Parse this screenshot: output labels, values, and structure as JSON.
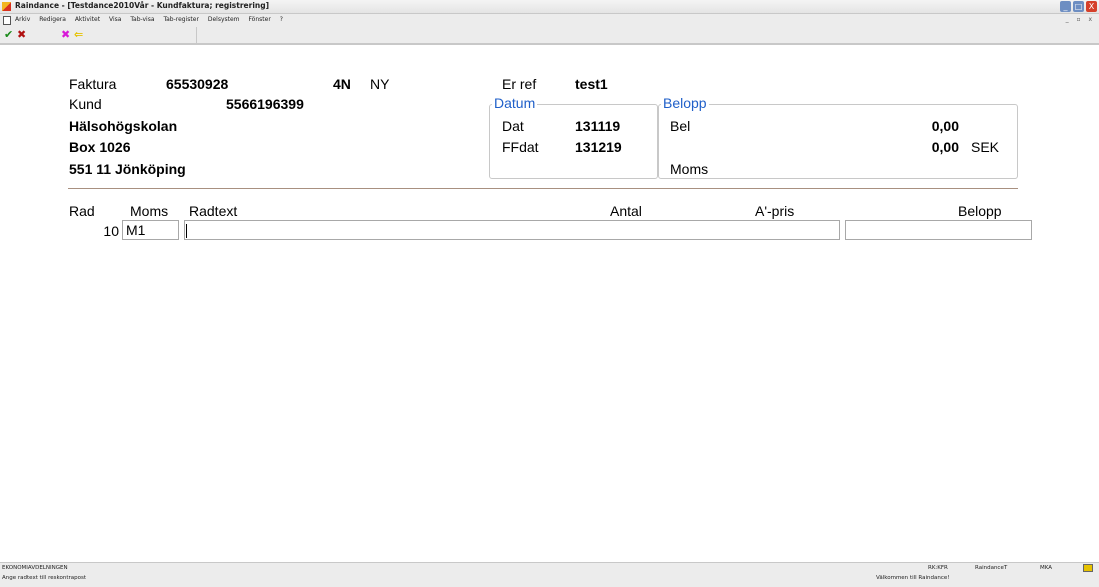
{
  "window": {
    "title": "Raindance - [Testdance2010Vår - Kundfaktura; registrering]",
    "min_glyph": "_",
    "max_glyph": "□",
    "close_glyph": "X",
    "mdi_controls": "_ ▫ x"
  },
  "menu": {
    "items": [
      "Arkiv",
      "Redigera",
      "Aktivitet",
      "Visa",
      "Tab-visa",
      "Tab-register",
      "Delsystem",
      "Fönster",
      "?"
    ]
  },
  "toolbar": {
    "check_glyph": "✔",
    "cancel_glyph": "✖",
    "mark_glyph": "✖",
    "arrow_glyph": "⇐"
  },
  "invoice": {
    "faktura_label": "Faktura",
    "faktura_number": "65530928",
    "code": "4N",
    "status": "NY",
    "kund_label": "Kund",
    "kund_number": "5566196399",
    "customer_name": "Hälsohögskolan",
    "address_line": "Box 1026",
    "postal_line": "551 11 Jönköping",
    "er_ref_label": "Er ref",
    "er_ref_value": "test1"
  },
  "datum": {
    "title": "Datum",
    "dat_label": "Dat",
    "dat_value": "131119",
    "ffdat_label": "FFdat",
    "ffdat_value": "131219"
  },
  "belopp": {
    "title": "Belopp",
    "bel_label": "Bel",
    "bel_value": "0,00",
    "total_value": "0,00",
    "currency": "SEK",
    "moms_label": "Moms"
  },
  "rows": {
    "headers": {
      "rad": "Rad",
      "moms": "Moms",
      "radtext": "Radtext",
      "antal": "Antal",
      "apris": "A'-pris",
      "belopp": "Belopp"
    },
    "row": {
      "rad": "10",
      "moms": "M1",
      "radtext": "",
      "belopp": ""
    }
  },
  "status": {
    "department": "EKONOMIAVDELNINGEN",
    "hint": "Ange radtext till reskontrapost",
    "rk": "RK:KFR",
    "system": "RaindanceT",
    "user": "MKA",
    "welcome": "Välkommen till Raindance!"
  }
}
